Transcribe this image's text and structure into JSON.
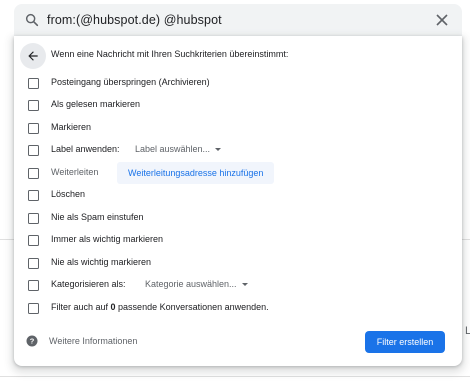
{
  "search": {
    "query": "from:(@hubspot.de) @hubspot",
    "icon": "search-icon",
    "clear_icon": "close-icon"
  },
  "header": {
    "text": "Wenn eine Nachricht mit Ihren Suchkriterien übereinstimmt:",
    "back_icon": "arrow-back-icon"
  },
  "options": {
    "skip_inbox": "Posteingang überspringen (Archivieren)",
    "mark_read": "Als gelesen markieren",
    "star": "Markieren",
    "apply_label": "Label anwenden:",
    "label_select": "Label auswählen...",
    "forward": "Weiterleiten",
    "forward_button": "Weiterleitungsadresse hinzufügen",
    "delete": "Löschen",
    "never_spam": "Nie als Spam einstufen",
    "always_important": "Immer als wichtig markieren",
    "never_important": "Nie als wichtig markieren",
    "categorize": "Kategorisieren als:",
    "category_select": "Kategorie auswählen...",
    "apply_existing_prefix": "Filter auch auf ",
    "apply_existing_count": "0",
    "apply_existing_suffix": " passende Konversationen anwenden."
  },
  "footer": {
    "help_text": "Weitere Informationen",
    "help_icon": "help-icon",
    "create_button": "Filter erstellen"
  },
  "background": {
    "edge_char": "L"
  },
  "colors": {
    "accent": "#1a73e8",
    "text": "#202124",
    "muted": "#5f6368",
    "search_bg": "#f1f3f4"
  }
}
